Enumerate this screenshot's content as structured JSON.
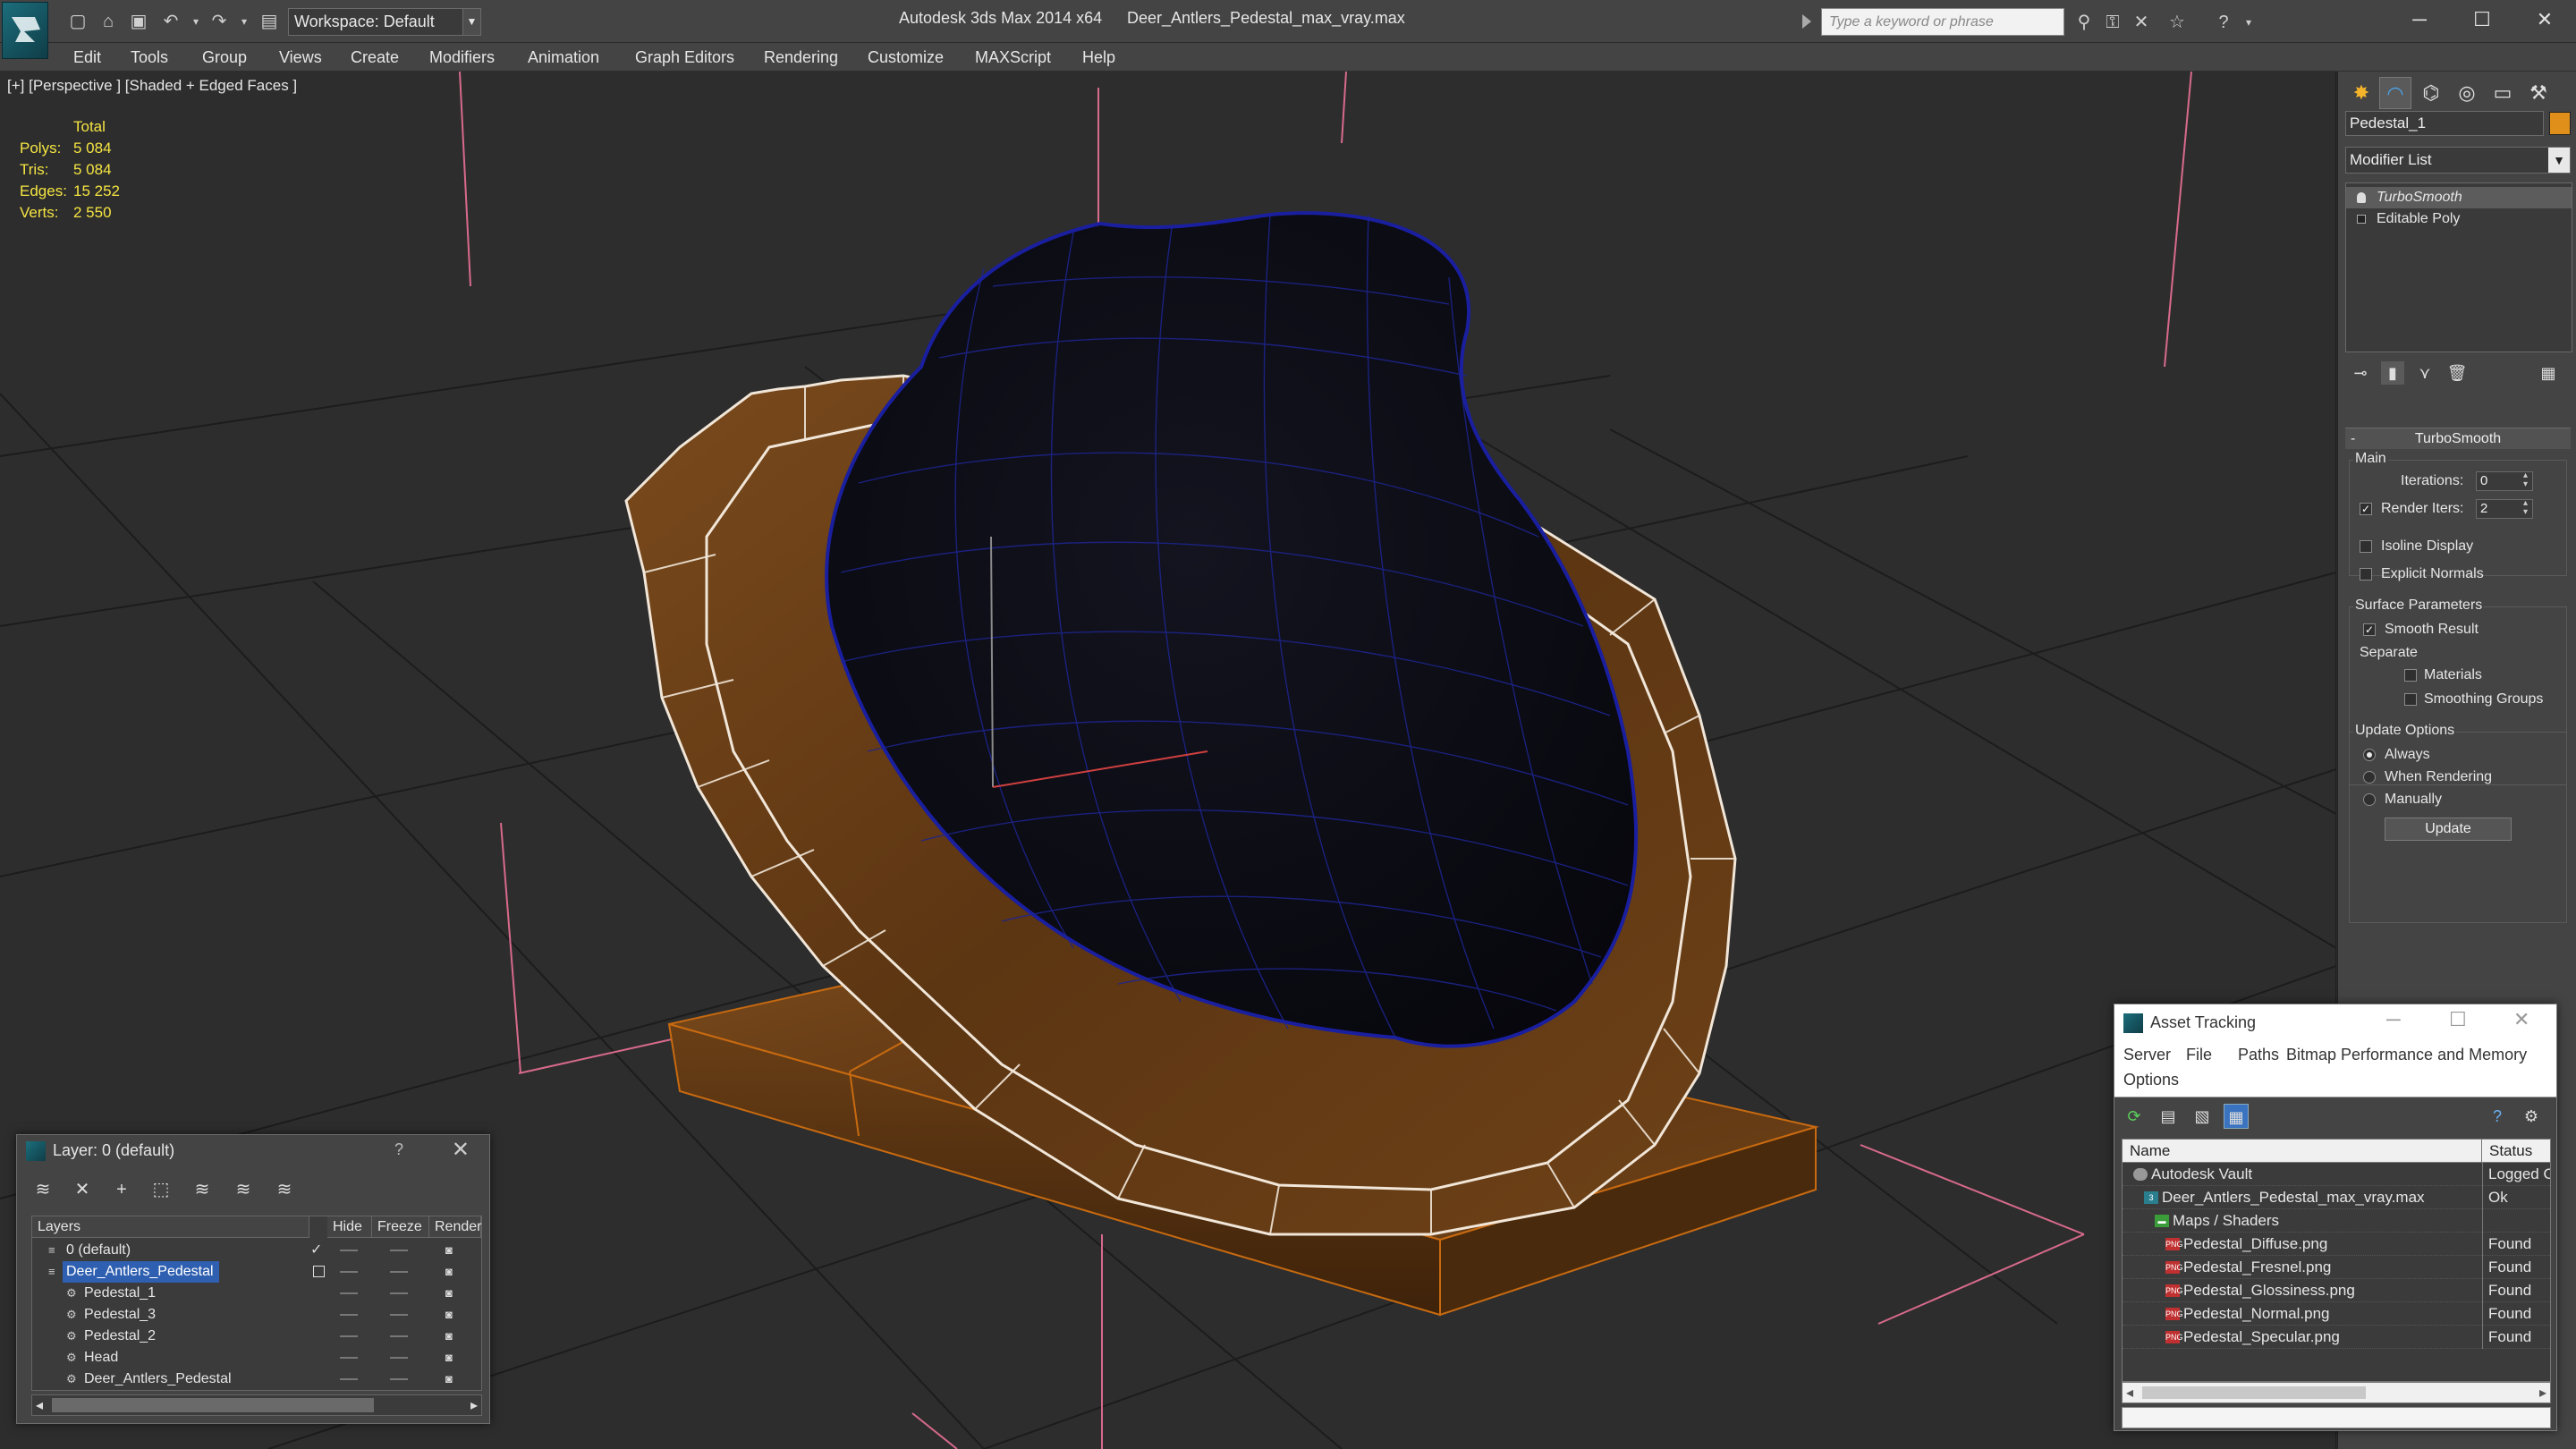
{
  "titlebar": {
    "workspace": "Workspace: Default",
    "app_title": "Autodesk 3ds Max  2014 x64",
    "file_title": "Deer_Antlers_Pedestal_max_vray.max",
    "search_placeholder": "Type a keyword or phrase"
  },
  "menu": [
    "Edit",
    "Tools",
    "Group",
    "Views",
    "Create",
    "Modifiers",
    "Animation",
    "Graph Editors",
    "Rendering",
    "Customize",
    "MAXScript",
    "Help"
  ],
  "viewport": {
    "label": "[+] [Perspective ] [Shaded + Edged Faces ]",
    "stats_header": "Total",
    "stats": [
      {
        "label": "Polys:",
        "value": "5 084"
      },
      {
        "label": "Tris:",
        "value": "5 084"
      },
      {
        "label": "Edges:",
        "value": "15 252"
      },
      {
        "label": "Verts:",
        "value": "2 550"
      }
    ]
  },
  "command_panel": {
    "object_name": "Pedestal_1",
    "object_color": "#e0901a",
    "modifier_list": "Modifier List",
    "stack": [
      "TurboSmooth",
      "Editable Poly"
    ],
    "rollout_title": "TurboSmooth",
    "main_label": "Main",
    "iterations_label": "Iterations:",
    "iterations_value": "0",
    "render_iters_label": "Render Iters:",
    "render_iters_value": "2",
    "isoline_label": "Isoline Display",
    "explicit_normals_label": "Explicit Normals",
    "surface_params_label": "Surface Parameters",
    "smooth_result_label": "Smooth Result",
    "separate_label": "Separate",
    "materials_label": "Materials",
    "smoothing_groups_label": "Smoothing Groups",
    "update_options_label": "Update Options",
    "always_label": "Always",
    "when_rendering_label": "When Rendering",
    "manually_label": "Manually",
    "update_button": "Update"
  },
  "layer_dialog": {
    "title": "Layer: 0 (default)",
    "help": "?",
    "columns": [
      "Layers",
      "Hide",
      "Freeze",
      "Render"
    ],
    "rows": [
      {
        "name": "0 (default)",
        "indent": 0,
        "selected": false
      },
      {
        "name": "Deer_Antlers_Pedestal",
        "indent": 0,
        "selected": true
      },
      {
        "name": "Pedestal_1",
        "indent": 1,
        "selected": false
      },
      {
        "name": "Pedestal_3",
        "indent": 1,
        "selected": false
      },
      {
        "name": "Pedestal_2",
        "indent": 1,
        "selected": false
      },
      {
        "name": "Head",
        "indent": 1,
        "selected": false
      },
      {
        "name": "Deer_Antlers_Pedestal",
        "indent": 1,
        "selected": false
      }
    ]
  },
  "asset_dialog": {
    "title": "Asset Tracking",
    "menu": [
      "Server",
      "File",
      "Paths",
      "Bitmap Performance and Memory",
      "Options"
    ],
    "columns": [
      "Name",
      "Status"
    ],
    "rows": [
      {
        "name": "Autodesk Vault",
        "status": "Logged O",
        "icon": "vault",
        "level": 0
      },
      {
        "name": "Deer_Antlers_Pedestal_max_vray.max",
        "status": "Ok",
        "icon": "max",
        "level": 1
      },
      {
        "name": "Maps / Shaders",
        "status": "",
        "icon": "folder",
        "level": 2
      },
      {
        "name": "Pedestal_Diffuse.png",
        "status": "Found",
        "icon": "png",
        "level": 3
      },
      {
        "name": "Pedestal_Fresnel.png",
        "status": "Found",
        "icon": "png",
        "level": 3
      },
      {
        "name": "Pedestal_Glossiness.png",
        "status": "Found",
        "icon": "png",
        "level": 3
      },
      {
        "name": "Pedestal_Normal.png",
        "status": "Found",
        "icon": "png",
        "level": 3
      },
      {
        "name": "Pedestal_Specular.png",
        "status": "Found",
        "icon": "png",
        "level": 3
      }
    ]
  }
}
